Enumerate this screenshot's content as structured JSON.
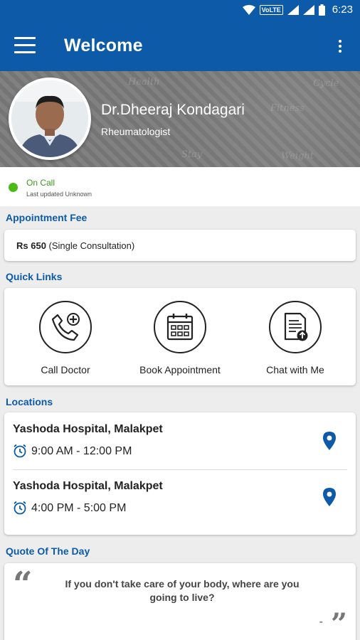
{
  "status_bar": {
    "network": "VoLTE",
    "time": "6:23"
  },
  "app_bar": {
    "title": "Welcome"
  },
  "profile": {
    "name": "Dr.Dheeraj Kondagari",
    "specialty": "Rheumatologist"
  },
  "on_call": {
    "status": "On Call",
    "updated": "Last updated Unknown",
    "status_color": "#4cbb17"
  },
  "appointment_fee": {
    "title": "Appointment Fee",
    "amount": "Rs 650",
    "note": "(Single Consultation)"
  },
  "quick_links": {
    "title": "Quick Links",
    "items": [
      {
        "label": "Call Doctor",
        "icon": "phone-plus-icon"
      },
      {
        "label": "Book Appointment",
        "icon": "calendar-icon"
      },
      {
        "label": "Chat with Me",
        "icon": "document-upload-icon"
      }
    ]
  },
  "locations": {
    "title": "Locations",
    "items": [
      {
        "name": "Yashoda Hospital, Malakpet",
        "time": "9:00 AM - 12:00 PM"
      },
      {
        "name": "Yashoda Hospital, Malakpet",
        "time": "4:00 PM - 5:00 PM"
      }
    ]
  },
  "quote": {
    "title": "Quote Of The Day",
    "text": "If you don't take care of your body, where are you going to live?",
    "author": "-"
  },
  "colors": {
    "primary": "#0d5ba8",
    "accent": "#0d5ba8"
  }
}
